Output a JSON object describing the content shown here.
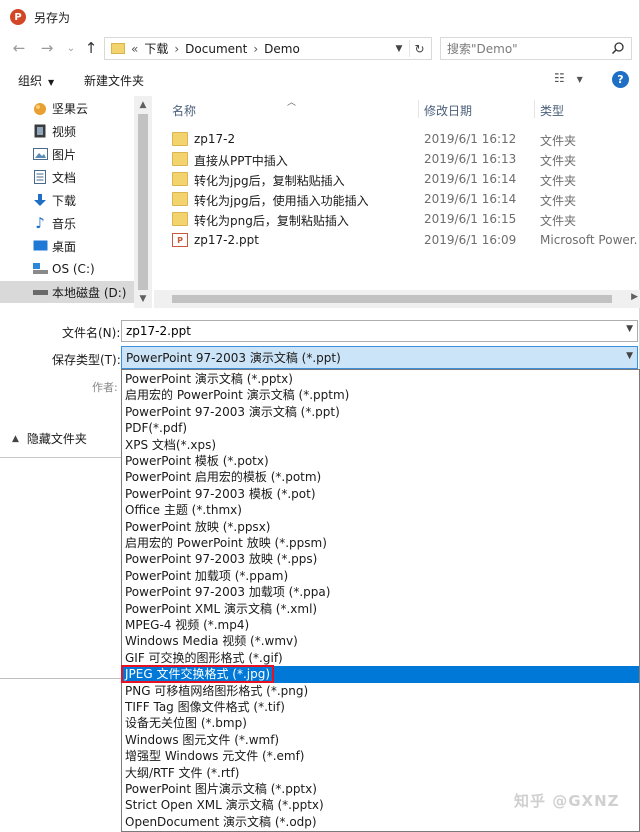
{
  "window": {
    "title": "另存为",
    "app_icon": "P"
  },
  "nav": {
    "back_icon": "←",
    "forward_icon": "→",
    "recent_icon": "⌄",
    "up_icon": "↑"
  },
  "address": {
    "overflow": "«",
    "segments": [
      "下载",
      "Document",
      "Demo"
    ],
    "separator": "›"
  },
  "search": {
    "placeholder": "搜索\"Demo\""
  },
  "toolbar": {
    "organize": "组织",
    "new_folder": "新建文件夹",
    "view_icon": "☷",
    "help": "?"
  },
  "sidebar": {
    "items": [
      {
        "label": "坚果云",
        "icon": "nut-cloud-icon"
      },
      {
        "label": "视频",
        "icon": "video-icon"
      },
      {
        "label": "图片",
        "icon": "picture-icon"
      },
      {
        "label": "文档",
        "icon": "document-icon"
      },
      {
        "label": "下载",
        "icon": "download-icon"
      },
      {
        "label": "音乐",
        "icon": "music-icon"
      },
      {
        "label": "桌面",
        "icon": "desktop-icon"
      },
      {
        "label": "OS (C:)",
        "icon": "drive-icon"
      },
      {
        "label": "本地磁盘 (D:)",
        "icon": "drive-icon"
      }
    ]
  },
  "columns": {
    "name": "名称",
    "date": "修改日期",
    "type": "类型"
  },
  "files": [
    {
      "name": "zp17-2",
      "date": "2019/6/1 16:12",
      "type": "文件夹",
      "kind": "folder"
    },
    {
      "name": "直接从PPT中插入",
      "date": "2019/6/1 16:13",
      "type": "文件夹",
      "kind": "folder"
    },
    {
      "name": "转化为jpg后，复制粘贴插入",
      "date": "2019/6/1 16:14",
      "type": "文件夹",
      "kind": "folder"
    },
    {
      "name": "转化为jpg后，使用插入功能插入",
      "date": "2019/6/1 16:14",
      "type": "文件夹",
      "kind": "folder"
    },
    {
      "name": "转化为png后，复制粘贴插入",
      "date": "2019/6/1 16:15",
      "type": "文件夹",
      "kind": "folder"
    },
    {
      "name": "zp17-2.ppt",
      "date": "2019/6/1 16:09",
      "type": "Microsoft Power...",
      "kind": "ppt"
    }
  ],
  "form": {
    "filename_label": "文件名(N):",
    "filename_value": "zp17-2.ppt",
    "savetype_label": "保存类型(T):",
    "savetype_value": "PowerPoint 97-2003 演示文稿 (*.ppt)",
    "author_label": "作者:",
    "hide_folders": "隐藏文件夹"
  },
  "save_types": [
    "PowerPoint 演示文稿 (*.pptx)",
    "启用宏的 PowerPoint 演示文稿 (*.pptm)",
    "PowerPoint 97-2003 演示文稿 (*.ppt)",
    "PDF(*.pdf)",
    "XPS 文档(*.xps)",
    "PowerPoint 模板 (*.potx)",
    "PowerPoint 启用宏的模板 (*.potm)",
    "PowerPoint 97-2003 模板 (*.pot)",
    "Office 主题 (*.thmx)",
    "PowerPoint 放映 (*.ppsx)",
    "启用宏的 PowerPoint 放映 (*.ppsm)",
    "PowerPoint 97-2003 放映 (*.pps)",
    "PowerPoint 加载项 (*.ppam)",
    "PowerPoint 97-2003 加载项 (*.ppa)",
    "PowerPoint XML 演示文稿 (*.xml)",
    "MPEG-4 视频 (*.mp4)",
    "Windows Media 视频 (*.wmv)",
    "GIF 可交换的图形格式 (*.gif)",
    "JPEG 文件交换格式 (*.jpg)",
    "PNG 可移植网络图形格式 (*.png)",
    "TIFF Tag 图像文件格式 (*.tif)",
    "设备无关位图 (*.bmp)",
    "Windows 图元文件 (*.wmf)",
    "增强型 Windows 元文件 (*.emf)",
    "大纲/RTF 文件 (*.rtf)",
    "PowerPoint 图片演示文稿 (*.pptx)",
    "Strict Open XML 演示文稿 (*.pptx)",
    "OpenDocument 演示文稿 (*.odp)"
  ],
  "highlighted_type_index": 18,
  "watermark": "知乎 @GXNZ",
  "colors": {
    "accent": "#0078d7",
    "highlight_border": "#e81123",
    "selected_bg": "#cce4f7"
  }
}
